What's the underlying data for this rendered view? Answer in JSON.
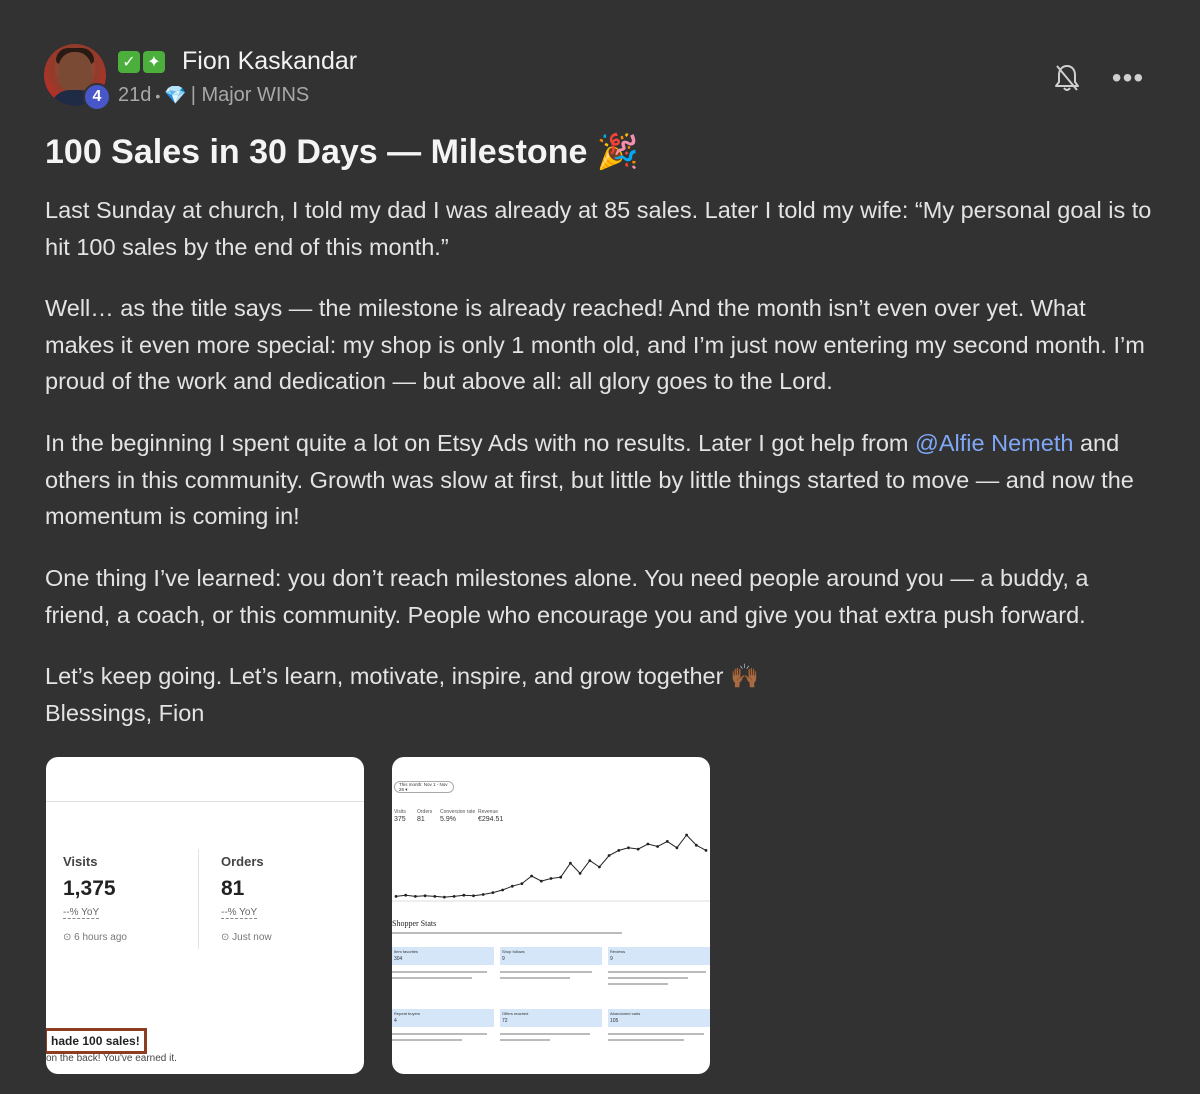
{
  "post": {
    "author": {
      "name": "Fion Kaskandar",
      "level": "4",
      "badges": [
        "✓",
        "✦"
      ],
      "avatar_icon": "user-avatar"
    },
    "meta": {
      "age": "21d",
      "separator": "•",
      "category": "| Major WINS",
      "category_icon": "gem-icon"
    },
    "actions": {
      "bell_icon": "bell-off-icon",
      "more_icon": "more-icon",
      "more_glyph": "•••"
    },
    "title": "100 Sales in 30 Days — Milestone 🎉",
    "paragraphs": [
      "Last Sunday at church, I told my dad I was already at 85 sales. Later I told my wife: “My personal goal is to hit 100 sales by the end of this month.”",
      "Well… as the title says — the milestone is already reached! And the month isn’t even over yet. What makes it even more special: my shop is only 1 month old, and I’m just now entering my second month. I’m proud of the work and dedication — but above all: all glory goes to the Lord.",
      {
        "before": "In the beginning I spent quite a lot on Etsy Ads with no results. Later I got help from ",
        "mention": "@Alfie Nemeth",
        "after": " and others in this community. Growth was slow at first, but little by little things started to move — and now the momentum is coming in!"
      },
      "One thing I’ve learned: you don’t reach milestones alone. You need people around you — a buddy, a friend, a coach, or this community. People who encourage you and give you that extra push forward.",
      "Let’s keep going. Let’s learn, motivate, inspire, and grow together 🙌🏾",
      "Blessings, Fion"
    ],
    "attachments": [
      {
        "stats": [
          {
            "label": "Visits",
            "value": "1,375",
            "yoy": "--% YoY",
            "time": "⊙ 6 hours ago"
          },
          {
            "label": "Orders",
            "value": "81",
            "yoy": "--% YoY",
            "time": "⊙ Just now"
          }
        ],
        "banner": "hade 100 sales!",
        "banner_sub": "on the back! You've earned it."
      },
      {
        "filter": "This month: Nov 1 - Nov 26 ▾",
        "chips": [
          "Visits",
          "Orders",
          "Conversion rate",
          "Revenue"
        ],
        "values": [
          "375",
          "81",
          "5.9%",
          "€294.51"
        ],
        "chart_line": [
          2,
          3,
          2,
          2.5,
          2,
          1.5,
          2,
          3,
          2.5,
          3.5,
          5,
          7,
          10,
          12,
          18,
          14,
          16,
          17,
          28,
          20,
          30,
          25,
          34,
          38,
          40,
          39,
          43,
          41,
          45,
          40,
          50,
          42,
          38
        ],
        "shopper_title": "Shopper Stats",
        "cells": [
          {
            "title": "Item favorites",
            "value": "304"
          },
          {
            "title": "Shop follows",
            "value": "9"
          },
          {
            "title": "Reviews",
            "value": "9"
          },
          {
            "title": "Repeat buyers",
            "value": "4"
          },
          {
            "title": "Offers reached",
            "value": "72"
          },
          {
            "title": "Abandoned carts",
            "value": "105"
          }
        ]
      }
    ]
  }
}
